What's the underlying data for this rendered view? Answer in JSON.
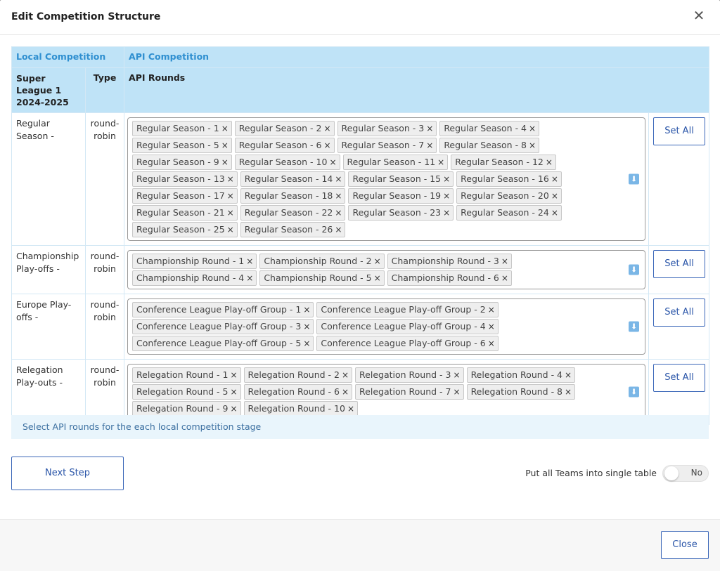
{
  "modal": {
    "title": "Edit Competition Structure",
    "close_icon": "close-icon"
  },
  "table": {
    "header_local": "Local Competition",
    "header_api": "API Competition",
    "col_competition": "Super League 1 2024-2025",
    "col_type": "Type",
    "col_api_rounds": "API Rounds",
    "rows": [
      {
        "name": "Regular Season -",
        "type": "round-robin",
        "button": "Set All",
        "tags": [
          "Regular Season - 1",
          "Regular Season - 2",
          "Regular Season - 3",
          "Regular Season - 4",
          "Regular Season - 5",
          "Regular Season - 6",
          "Regular Season - 7",
          "Regular Season - 8",
          "Regular Season - 9",
          "Regular Season - 10",
          "Regular Season - 11",
          "Regular Season - 12",
          "Regular Season - 13",
          "Regular Season - 14",
          "Regular Season - 15",
          "Regular Season - 16",
          "Regular Season - 17",
          "Regular Season - 18",
          "Regular Season - 19",
          "Regular Season - 20",
          "Regular Season - 21",
          "Regular Season - 22",
          "Regular Season - 23",
          "Regular Season - 24",
          "Regular Season - 25",
          "Regular Season - 26"
        ]
      },
      {
        "name": "Championship Play-offs -",
        "type": "round-robin",
        "button": "Set All",
        "tags": [
          "Championship Round - 1",
          "Championship Round - 2",
          "Championship Round - 3",
          "Championship Round - 4",
          "Championship Round - 5",
          "Championship Round - 6"
        ]
      },
      {
        "name": "Europe Play-offs -",
        "type": "round-robin",
        "button": "Set All",
        "tags": [
          "Conference League Play-off Group - 1",
          "Conference League Play-off Group - 2",
          "Conference League Play-off Group - 3",
          "Conference League Play-off Group - 4",
          "Conference League Play-off Group - 5",
          "Conference League Play-off Group - 6"
        ]
      },
      {
        "name": "Relegation Play-outs -",
        "type": "round-robin",
        "button": "Set All",
        "tags": [
          "Relegation Round - 1",
          "Relegation Round - 2",
          "Relegation Round - 3",
          "Relegation Round - 4",
          "Relegation Round - 5",
          "Relegation Round - 6",
          "Relegation Round - 7",
          "Relegation Round - 8",
          "Relegation Round - 9",
          "Relegation Round - 10"
        ]
      }
    ]
  },
  "info": "Select API rounds for the each local competition stage",
  "next_step": "Next Step",
  "single_table": {
    "label": "Put all Teams into single table",
    "toggle_value": "No"
  },
  "footer": {
    "close_label": "Close"
  },
  "colors": {
    "header_bg": "#bfe3f7",
    "accent": "#2a55a8",
    "header_text": "#2f8fd0"
  }
}
